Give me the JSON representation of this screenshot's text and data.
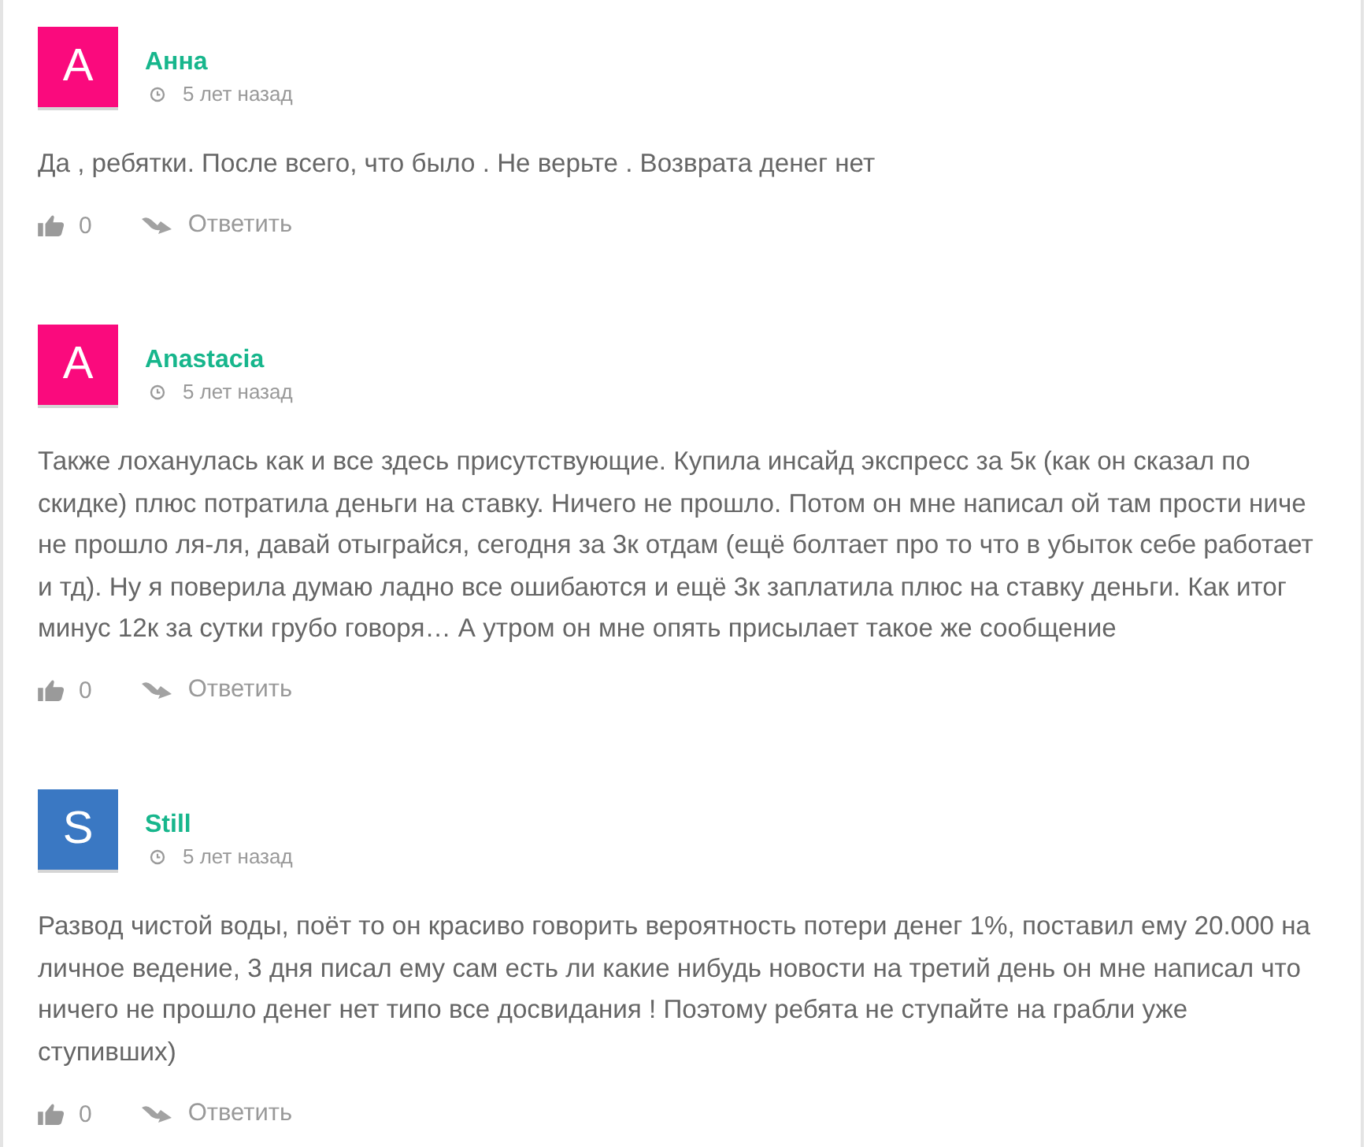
{
  "comments": [
    {
      "author": "Анна",
      "initial": "A",
      "color": "#fa0a7d",
      "time": "5 лет назад",
      "text": "Да , ребятки. После всего, что было . Не верьте . Возврата денег нет",
      "likes": "0",
      "reply": "Ответить"
    },
    {
      "author": "Anastacia",
      "initial": "A",
      "color": "#fa0a7d",
      "time": "5 лет назад",
      "text": "Также лоханулась как и все здесь присутствующие. Купила инсайд экспресс за 5к (как он сказал по скидке) плюс потратила деньги на ставку. Ничего не прошло. Потом он мне написал ой там прости ниче не прошло ля-ля, давай отыграйся, сегодня за 3к отдам (ещё болтает про то что в убыток себе работает и тд). Ну я поверила думаю ладно все ошибаются и ещё 3к заплатила плюс на ставку деньги. Как итог минус 12к за сутки грубо говоря… А утром он мне опять присылает такое же сообщение",
      "likes": "0",
      "reply": "Ответить"
    },
    {
      "author": "Still",
      "initial": "S",
      "color": "#3a78c3",
      "time": "5 лет назад",
      "text": "Развод чистой воды, поёт то он красиво говорить вероятность потери денег 1%, поставил ему 20.000 на личное ведение, 3 дня писал ему сам есть ли какие нибудь новости на третий день он мне написал что ничего не прошло денег нет типо все досвидания ! Поэтому ребята не ступайте на грабли уже ступивших)",
      "likes": "0",
      "reply": "Ответить"
    }
  ]
}
